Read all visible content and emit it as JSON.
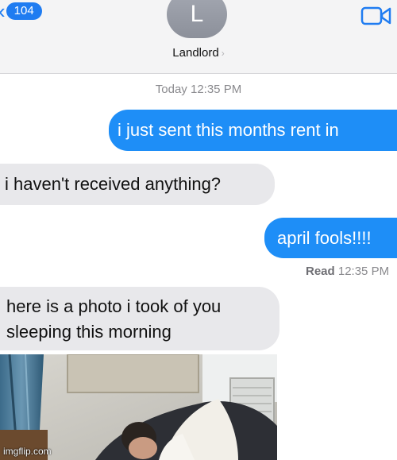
{
  "header": {
    "back_count": "104",
    "avatar_initial": "L",
    "contact_name": "Landlord"
  },
  "timestamp": {
    "day": "Today",
    "time": "12:35 PM"
  },
  "messages": [
    {
      "direction": "sent",
      "text": "i just sent this months rent in"
    },
    {
      "direction": "received",
      "text": "i haven't received anything?"
    },
    {
      "direction": "sent",
      "text": "april fools!!!!"
    },
    {
      "direction": "received",
      "text": "here is a photo i took of you sleeping this morning"
    }
  ],
  "read_receipt": {
    "label": "Read",
    "time": "12:35 PM"
  },
  "watermark": {
    "site": "imgflip.com"
  },
  "colors": {
    "sent_bubble": "#1e8ef7",
    "received_bubble": "#e8e8eb",
    "accent": "#1f7cf1"
  }
}
